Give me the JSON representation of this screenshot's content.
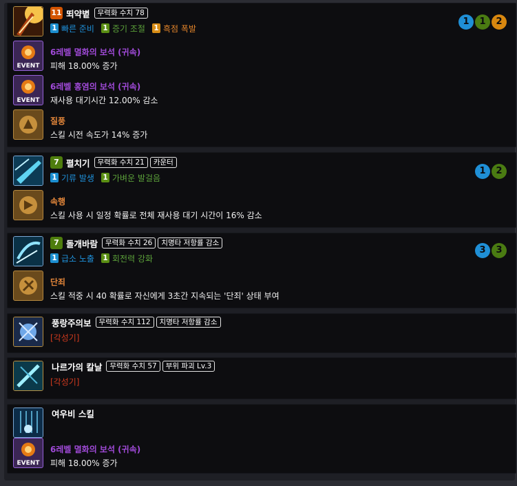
{
  "skills": [
    {
      "level": "11",
      "name": "뙤약볕",
      "tags": [
        "무력화 수치 78"
      ],
      "tripods": [
        {
          "num": "1",
          "name": "빠른 준비"
        },
        {
          "num": "1",
          "name": "증기 조절"
        },
        {
          "num": "1",
          "name": "흑점 폭발"
        }
      ],
      "tripod_levels": [
        "1",
        "1",
        "2"
      ],
      "gems": [
        {
          "title": "6레벨 멸화의 보석 (귀속)",
          "desc": "피해 18.00% 증가",
          "icon_label": "EVENT"
        },
        {
          "title": "6레벨 홍염의 보석 (귀속)",
          "desc": "재사용 대기시간 12.00% 감소",
          "icon_label": "EVENT"
        }
      ],
      "rune": {
        "name": "질풍",
        "desc": "스킬 시전 속도가 14% 증가"
      }
    },
    {
      "level": "7",
      "name": "펼치기",
      "tags": [
        "무력화 수치 21",
        "카운터"
      ],
      "tripods": [
        {
          "num": "1",
          "name": "기류 발생"
        },
        {
          "num": "1",
          "name": "가벼운 발걸음"
        }
      ],
      "tripod_levels": [
        "1",
        "2"
      ],
      "rune": {
        "name": "속행",
        "desc": "스킬 사용 시 일정 확률로 전체 재사용 대기 시간이 16% 감소"
      }
    },
    {
      "level": "7",
      "name": "돌개바람",
      "tags": [
        "무력화 수치 26",
        "치명타 저항률 감소"
      ],
      "tripods": [
        {
          "num": "1",
          "name": "급소 노출"
        },
        {
          "num": "1",
          "name": "회전력 강화"
        }
      ],
      "tripod_levels": [
        "3",
        "3"
      ],
      "rune": {
        "name": "단죄",
        "desc": "스킬 적중 시 40 확률로 자신에게 3초간 지속되는 '단죄' 상태 부여"
      }
    },
    {
      "name": "풍랑주의보",
      "tags": [
        "무력화 수치 112",
        "치명타 저항률 감소"
      ],
      "awakening": "[각성기]"
    },
    {
      "name": "나르가의 칼날",
      "tags": [
        "무력화 수치 57",
        "부위 파괴 Lv.3"
      ],
      "awakening": "[각성기]"
    },
    {
      "name": "여우비 스킬",
      "gems": [
        {
          "title": "6레벨 멸화의 보석 (귀속)",
          "desc": "피해 18.00% 증가",
          "icon_label": "EVENT"
        }
      ]
    }
  ]
}
